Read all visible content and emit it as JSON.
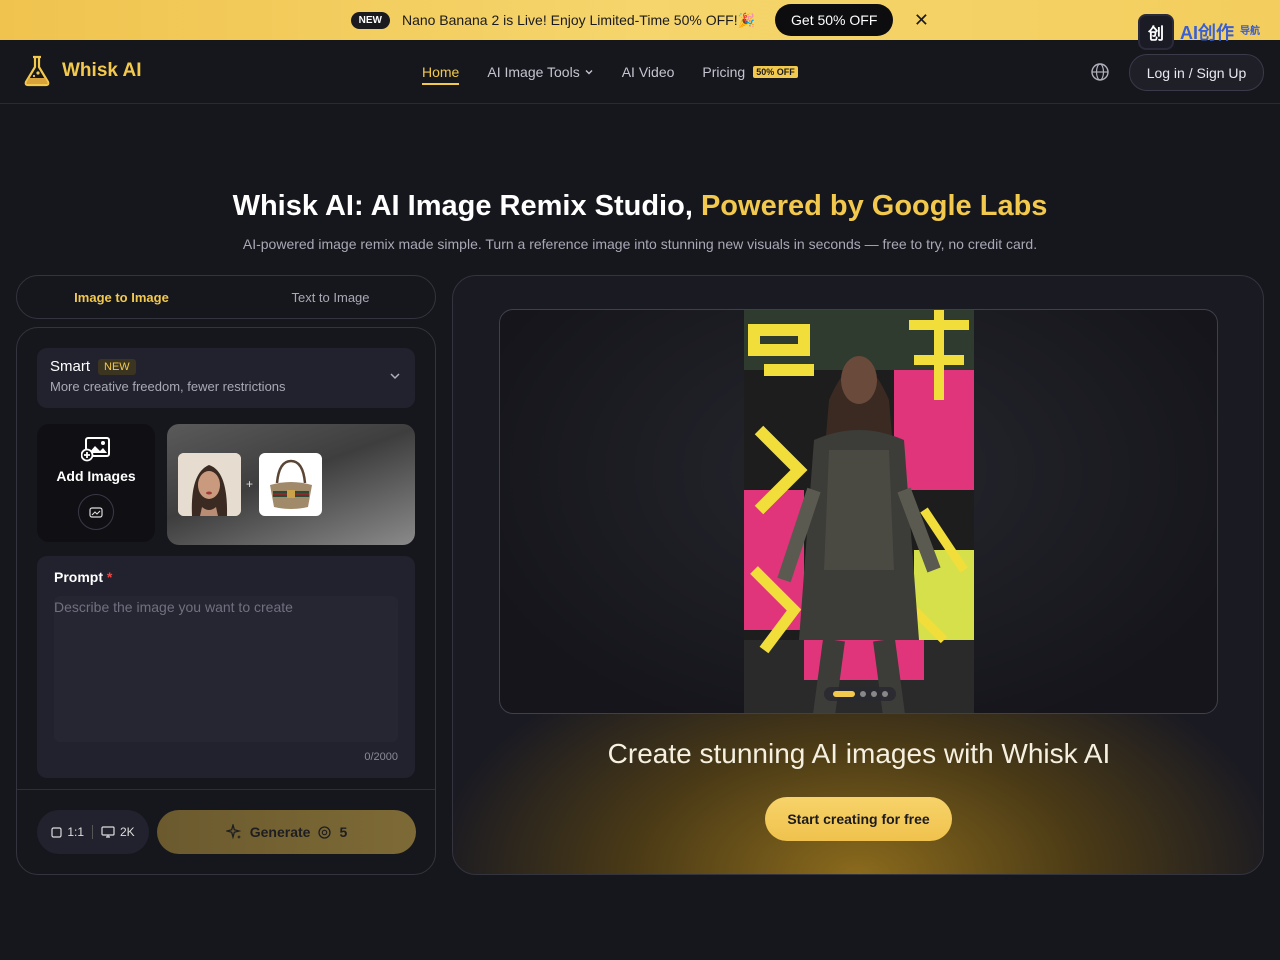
{
  "promo": {
    "badge": "NEW",
    "message": "Nano Banana 2 is Live! Enjoy Limited-Time 50% OFF!🎉",
    "cta": "Get 50% OFF",
    "close_icon": "close-icon"
  },
  "corner_logo": {
    "mark": "创",
    "text": "AI创作",
    "sub": "导航"
  },
  "nav": {
    "brand": "Whisk AI",
    "items": [
      {
        "label": "Home",
        "active": true
      },
      {
        "label": "AI Image Tools",
        "has_dropdown": true
      },
      {
        "label": "AI Video"
      },
      {
        "label": "Pricing",
        "badge": "50% OFF"
      }
    ],
    "login": "Log in / Sign Up",
    "globe_icon": "globe-icon"
  },
  "hero": {
    "title_main": "Whisk AI: AI Image Remix Studio, ",
    "title_highlight": "Powered by Google Labs",
    "subtitle": "AI-powered image remix made simple. Turn a reference image into stunning new visuals in seconds — free to try, no credit card."
  },
  "tabs": [
    {
      "label": "Image to Image",
      "active": true
    },
    {
      "label": "Text to Image",
      "active": false
    }
  ],
  "model": {
    "name": "Smart",
    "badge": "NEW",
    "description": "More creative freedom, fewer restrictions"
  },
  "add_images": {
    "label": "Add Images"
  },
  "prompt": {
    "label": "Prompt",
    "required_mark": "*",
    "placeholder": "Describe the image you want to create",
    "value": "",
    "counter": "0/2000"
  },
  "options": {
    "aspect_ratio": "1:1",
    "resolution": "2K"
  },
  "generate": {
    "label": "Generate",
    "credits": "5"
  },
  "showcase": {
    "title": "Create stunning AI images with Whisk AI",
    "cta": "Start creating for free",
    "carousel_count": 4,
    "carousel_active_index": 0
  },
  "colors": {
    "accent": "#f2c94c",
    "background": "#16161d",
    "panel_border": "#34343f"
  }
}
